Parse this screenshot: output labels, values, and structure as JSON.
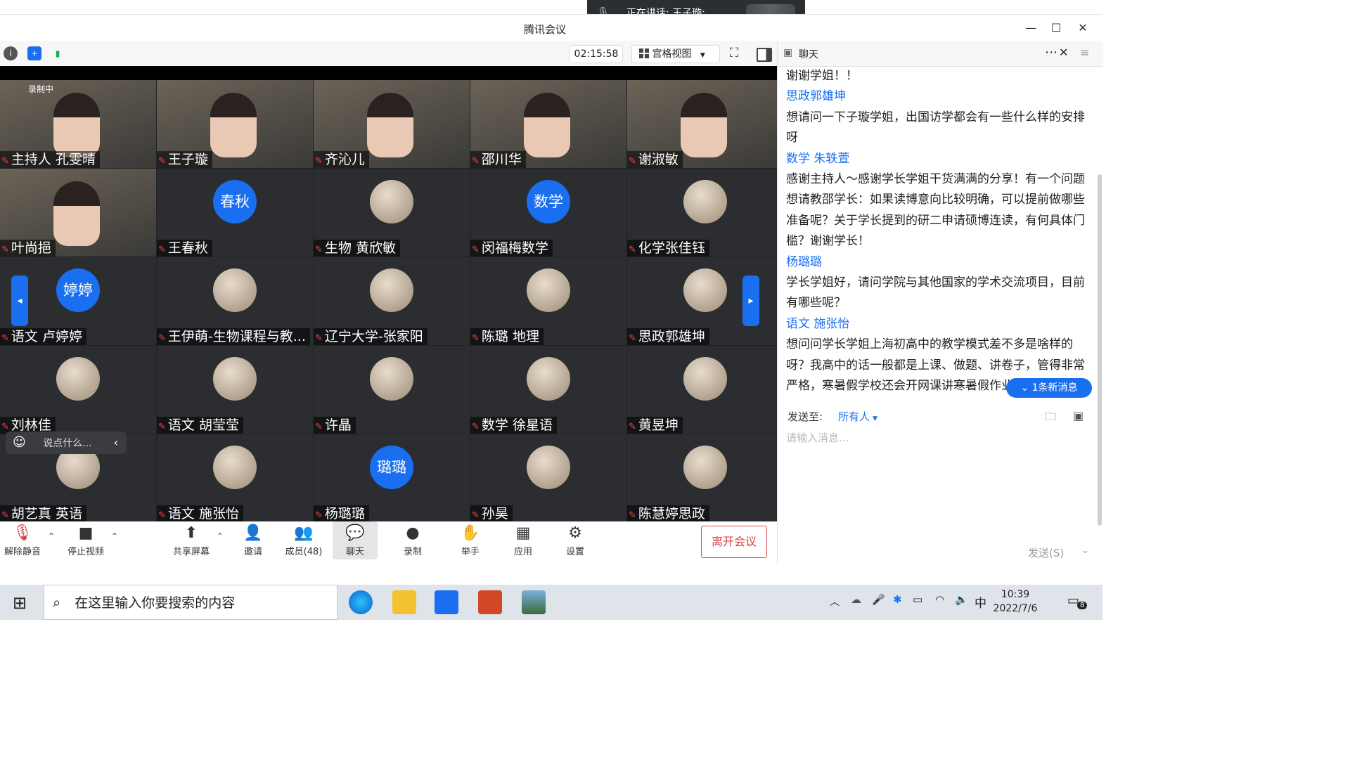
{
  "speaking": {
    "text": "正在讲话: 王子璇;"
  },
  "window": {
    "title": "腾讯会议",
    "minimize": "—",
    "maximize": "☐",
    "close": "✕"
  },
  "toolbar": {
    "timer": "02:15:58",
    "view_label": "宫格视图",
    "view_caret": "▼"
  },
  "recording_label": "录制中",
  "participants": [
    {
      "name": "主持人 孔雯晴",
      "type": "photo"
    },
    {
      "name": "王子璇",
      "type": "photo"
    },
    {
      "name": "齐沁儿",
      "type": "photo"
    },
    {
      "name": "邵川华",
      "type": "photo"
    },
    {
      "name": "谢淑敏",
      "type": "photo"
    },
    {
      "name": "叶尚挹",
      "type": "photo"
    },
    {
      "name": "王春秋",
      "type": "text",
      "avatar": "春秋"
    },
    {
      "name": "生物 黄欣敏",
      "type": "img"
    },
    {
      "name": "闵福梅数学",
      "type": "text",
      "avatar": "数学"
    },
    {
      "name": "化学张佳钰",
      "type": "img"
    },
    {
      "name": "语文 卢婷婷",
      "type": "text",
      "avatar": "婷婷"
    },
    {
      "name": "王伊萌-生物课程与教...",
      "type": "img"
    },
    {
      "name": "辽宁大学-张家阳",
      "type": "img"
    },
    {
      "name": "陈璐 地理",
      "type": "img"
    },
    {
      "name": "思政郭雄坤",
      "type": "img"
    },
    {
      "name": "刘林佳",
      "type": "img"
    },
    {
      "name": "语文 胡莹莹",
      "type": "img"
    },
    {
      "name": "许晶",
      "type": "img"
    },
    {
      "name": "数学 徐星语",
      "type": "img"
    },
    {
      "name": "黄昱坤",
      "type": "img"
    },
    {
      "name": "胡艺真 英语",
      "type": "img"
    },
    {
      "name": "语文 施张怡",
      "type": "img"
    },
    {
      "name": "杨璐璐",
      "type": "text",
      "avatar": "璐璐"
    },
    {
      "name": "孙昊",
      "type": "img"
    },
    {
      "name": "陈慧婷思政",
      "type": "img"
    }
  ],
  "chat_input_mini": "说点什么...",
  "controls": {
    "unmute": "解除静音",
    "stop_video": "停止视频",
    "share": "共享屏幕",
    "invite": "邀请",
    "members": "成员(48)",
    "chat": "聊天",
    "record": "录制",
    "raise_hand": "举手",
    "apps": "应用",
    "settings": "设置",
    "leave": "离开会议"
  },
  "chat_panel": {
    "title": "聊天",
    "messages": [
      {
        "kind": "msg",
        "text": "谢谢学姐！！"
      },
      {
        "kind": "sender",
        "text": "思政郭雄坤"
      },
      {
        "kind": "msg",
        "text": "想请问一下子璇学姐，出国访学都会有一些什么样的安排"
      },
      {
        "kind": "msg",
        "text": "呀"
      },
      {
        "kind": "sender",
        "text": "数学 朱轶萱"
      },
      {
        "kind": "msg",
        "text": "感谢主持人～感谢学长学姐干货满满的分享！有一个问题"
      },
      {
        "kind": "msg",
        "text": "想请教邵学长：如果读博意向比较明确，可以提前做哪些"
      },
      {
        "kind": "msg",
        "text": "准备呢？关于学长提到的研二申请硕博连读，有何具体门"
      },
      {
        "kind": "msg",
        "text": "槛？谢谢学长！"
      },
      {
        "kind": "sender",
        "text": "杨璐璐"
      },
      {
        "kind": "msg",
        "text": "学长学姐好，请问学院与其他国家的学术交流项目，目前"
      },
      {
        "kind": "msg",
        "text": "有哪些呢？"
      },
      {
        "kind": "sender",
        "text": "语文 施张怡"
      },
      {
        "kind": "msg",
        "text": "想问问学长学姐上海初高中的教学模式差不多是啥样的"
      },
      {
        "kind": "msg",
        "text": "呀？我高中的话一般都是上课、做题、讲卷子，管得非常"
      },
      {
        "kind": "msg",
        "text": "严格，寒暑假学校还会开网课讲寒暑假作业。"
      }
    ],
    "new_message": "1条新消息",
    "send_to_label": "发送至:",
    "send_to_value": "所有人",
    "input_placeholder": "请输入消息...",
    "send_button": "发送(S)"
  },
  "taskbar": {
    "search_placeholder": "在这里输入你要搜索的内容",
    "ime": "中",
    "time": "10:39",
    "date": "2022/7/6",
    "notifications": "8"
  }
}
